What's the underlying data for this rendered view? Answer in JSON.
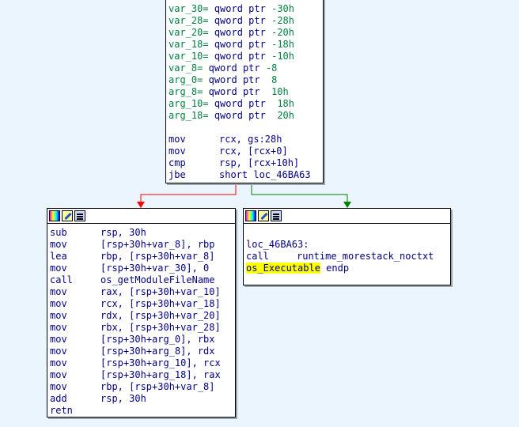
{
  "top_block": {
    "vars": [
      {
        "name": "var_30",
        "sep": "=",
        "type": "qword ptr",
        "val": "-30h"
      },
      {
        "name": "var_28",
        "sep": "=",
        "type": "qword ptr",
        "val": "-28h"
      },
      {
        "name": "var_20",
        "sep": "=",
        "type": "qword ptr",
        "val": "-20h"
      },
      {
        "name": "var_18",
        "sep": "=",
        "type": "qword ptr",
        "val": "-18h"
      },
      {
        "name": "var_10",
        "sep": "=",
        "type": "qword ptr",
        "val": "-10h"
      },
      {
        "name": "var_8",
        "sep": "=",
        "type": "qword ptr",
        "val": "-8"
      },
      {
        "name": "arg_0",
        "sep": "=",
        "type": "qword ptr",
        "val": " 8"
      },
      {
        "name": "arg_8",
        "sep": "=",
        "type": "qword ptr",
        "val": " 10h"
      },
      {
        "name": "arg_10",
        "sep": "=",
        "type": "qword ptr",
        "val": " 18h"
      },
      {
        "name": "arg_18",
        "sep": "=",
        "type": "qword ptr",
        "val": " 20h"
      }
    ],
    "insns": [
      {
        "mn": "mov",
        "ops": "rcx, gs:28h"
      },
      {
        "mn": "mov",
        "ops": "rcx, [rcx+0]"
      },
      {
        "mn": "cmp",
        "ops": "rsp, [rcx+10h]"
      },
      {
        "mn": "jbe",
        "ops": "short loc_46BA63"
      }
    ]
  },
  "left_block": {
    "insns": [
      {
        "mn": "sub",
        "ops": "rsp, 30h"
      },
      {
        "mn": "mov",
        "ops": "[rsp+30h+var_8], rbp"
      },
      {
        "mn": "lea",
        "ops": "rbp, [rsp+30h+var_8]"
      },
      {
        "mn": "mov",
        "ops": "[rsp+30h+var_30], 0"
      },
      {
        "mn": "call",
        "ops": "os_getModuleFileName"
      },
      {
        "mn": "mov",
        "ops": "rax, [rsp+30h+var_10]"
      },
      {
        "mn": "mov",
        "ops": "rcx, [rsp+30h+var_18]"
      },
      {
        "mn": "mov",
        "ops": "rdx, [rsp+30h+var_20]"
      },
      {
        "mn": "mov",
        "ops": "rbx, [rsp+30h+var_28]"
      },
      {
        "mn": "mov",
        "ops": "[rsp+30h+arg_0], rbx"
      },
      {
        "mn": "mov",
        "ops": "[rsp+30h+arg_8], rdx"
      },
      {
        "mn": "mov",
        "ops": "[rsp+30h+arg_10], rcx"
      },
      {
        "mn": "mov",
        "ops": "[rsp+30h+arg_18], rax"
      },
      {
        "mn": "mov",
        "ops": "rbp, [rsp+30h+var_8]"
      },
      {
        "mn": "add",
        "ops": "rsp, 30h"
      },
      {
        "mn": "retn",
        "ops": ""
      }
    ]
  },
  "right_block": {
    "label": "loc_46BA63:",
    "call_mn": "call",
    "call_target": "runtime_morestack_noctxt",
    "func_name": "os_Executable",
    "endp": "endp"
  },
  "colors": {
    "false_edge": "#ff0000",
    "true_edge": "#008000",
    "background": "#eaf5fd",
    "highlight": "#ffff00"
  },
  "icons": [
    "color-icon",
    "edit-icon",
    "graph-icon"
  ]
}
